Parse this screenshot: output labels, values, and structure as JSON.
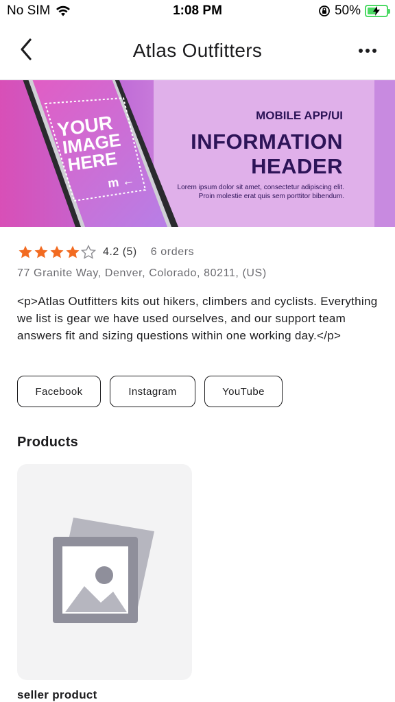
{
  "status_bar": {
    "carrier": "No SIM",
    "time": "1:08 PM",
    "battery": "50%",
    "battery_level": 0.5
  },
  "nav": {
    "title": "Atlas Outfitters",
    "back_icon": "chevron-left-icon",
    "more_icon": "more-horizontal-icon"
  },
  "banner": {
    "mockup_text_line1": "YOUR",
    "mockup_text_line2": "IMAGE",
    "mockup_text_line3": "HERE",
    "subtitle": "MOBILE APP/UI",
    "headline_line1": "INFORMATION",
    "headline_line2": "HEADER",
    "body_line1": "Lorem ipsum dolor sit amet, consectetur adipiscing elit.",
    "body_line2": "Proin molestie erat quis sem porttitor bibendum."
  },
  "store": {
    "rating_value": 4.2,
    "rating_text": "4.2 (5)",
    "orders": "6 orders",
    "address": "77 Granite Way, Denver, Colorado, 80211, (US)",
    "description": "<p>Atlas Outfitters kits out hikers, climbers and cyclists. Everything we list is gear we have used ourselves, and our support team answers fit and sizing questions within one working day.</p>"
  },
  "social": [
    {
      "label": "Facebook"
    },
    {
      "label": "Instagram"
    },
    {
      "label": "YouTube"
    }
  ],
  "products_section": {
    "title": "Products",
    "items": [
      {
        "name": "seller product",
        "image_icon": "image-placeholder-icon"
      }
    ]
  },
  "colors": {
    "star_filled": "#f26b21",
    "star_empty": "#8e8e93",
    "battery": "#4cd964",
    "banner_text": "#2d1458"
  }
}
